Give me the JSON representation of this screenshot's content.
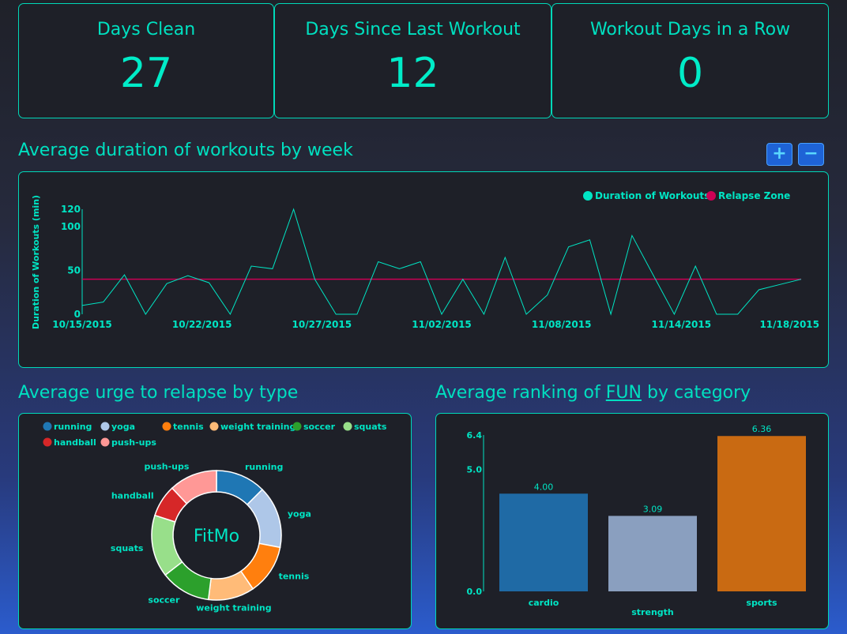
{
  "stats": [
    {
      "title": "Days Clean",
      "value": "27"
    },
    {
      "title": "Days Since Last Workout",
      "value": "12"
    },
    {
      "title": "Workout Days in a Row",
      "value": "0"
    }
  ],
  "duration_section": {
    "title": "Average duration of workouts by week",
    "zoom_in_label": "+",
    "zoom_out_label": "−"
  },
  "urge_section": {
    "title": "Average urge to relapse by type",
    "center_label": "FitMo"
  },
  "fun_section": {
    "title_prefix": "Average ranking of ",
    "title_fun": "FUN",
    "title_suffix": " by category"
  },
  "colors": {
    "accent": "#00e5c4",
    "relapse": "#cc0055",
    "panel_bg": "#1e2028"
  },
  "chart_data": [
    {
      "type": "line",
      "ylabel": "Duration of Workouts (min)",
      "ylim": [
        0,
        120
      ],
      "y_ticks": [
        "0",
        "50",
        "100",
        "120"
      ],
      "x_ticks": [
        "10/15/2015",
        "10/22/2015",
        "10/27/2015",
        "11/02/2015",
        "11/08/2015",
        "11/14/2015",
        "11/18/2015"
      ],
      "legend": {
        "placement": "top-right"
      },
      "series": [
        {
          "name": "Duration of Workouts",
          "color": "#00e5c4",
          "values": [
            10,
            14,
            45,
            0,
            35,
            44,
            36,
            0,
            55,
            52,
            120,
            40,
            0,
            0,
            60,
            52,
            60,
            0,
            40,
            0,
            65,
            0,
            22,
            77,
            85,
            0,
            90,
            45,
            0,
            55,
            0,
            0,
            28,
            34,
            40
          ]
        },
        {
          "name": "Relapse Zone",
          "color": "#cc0055",
          "values": [
            40,
            40
          ]
        }
      ]
    },
    {
      "type": "pie",
      "legend": [
        "running",
        "yoga",
        "tennis",
        "weight training",
        "soccer",
        "squats",
        "handball",
        "push-ups"
      ],
      "slices": [
        {
          "label": "running",
          "value": 12.5,
          "color": "#1f77b4"
        },
        {
          "label": "yoga",
          "value": 15.5,
          "color": "#aec7e8"
        },
        {
          "label": "tennis",
          "value": 12.5,
          "color": "#ff7f0e"
        },
        {
          "label": "weight training",
          "value": 11.5,
          "color": "#ffbb78"
        },
        {
          "label": "soccer",
          "value": 12.5,
          "color": "#2ca02c"
        },
        {
          "label": "squats",
          "value": 15.5,
          "color": "#98df8a"
        },
        {
          "label": "handball",
          "value": 8,
          "color": "#d62728"
        },
        {
          "label": "push-ups",
          "value": 12,
          "color": "#ff9896"
        }
      ]
    },
    {
      "type": "bar",
      "categories": [
        "cardio",
        "strength",
        "sports"
      ],
      "values": [
        4.0,
        3.09,
        6.36
      ],
      "value_labels": [
        "4.00",
        "3.09",
        "6.36"
      ],
      "colors": [
        "#1f6aa5",
        "#8a9fbf",
        "#c96a12"
      ],
      "ylim": [
        0,
        6.4
      ],
      "y_ticks": [
        "0.0",
        "5.0",
        "6.4"
      ]
    }
  ]
}
